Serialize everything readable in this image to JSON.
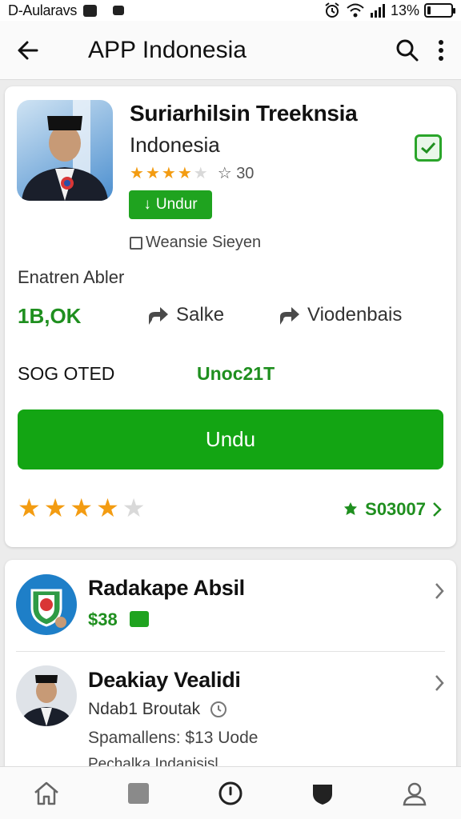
{
  "status_bar": {
    "carrier": "D-Aularavs",
    "battery_text": "13%",
    "battery_level": 0.13
  },
  "app_bar": {
    "title": "APP Indonesia",
    "icons": [
      "back-arrow-icon",
      "search-icon",
      "more-vert-icon"
    ]
  },
  "app": {
    "name": "Suriarhilsin Treeknsia",
    "subtitle": "Indonesia",
    "rating": 3.5,
    "rating_count": "30",
    "install_label": "Undur",
    "checkbox_label": "Weansie Sieyen",
    "section_label": "Enatren Abler"
  },
  "stats": {
    "downloads": "1B,OK",
    "share_label": "Salke",
    "more_label": "Viodenbais"
  },
  "details": {
    "left": "SOG OTED",
    "right": "Unoc21T"
  },
  "primary_button": "Undu",
  "reviews": {
    "stars": 4,
    "link_text": "S03007"
  },
  "related": [
    {
      "title": "Radakape Absil",
      "price": "$38"
    },
    {
      "title": "Deakiay Vealidi",
      "line1": "Ndab1 Broutak",
      "line2": "Spamallens: $13 Uode",
      "line3": "Pechalka Indanisisl"
    }
  ],
  "bottom_nav": [
    "home-icon",
    "square-icon",
    "compass-icon",
    "shield-icon",
    "profile-icon"
  ],
  "colors": {
    "accent_green": "#13a513",
    "star_orange": "#f39c12"
  }
}
